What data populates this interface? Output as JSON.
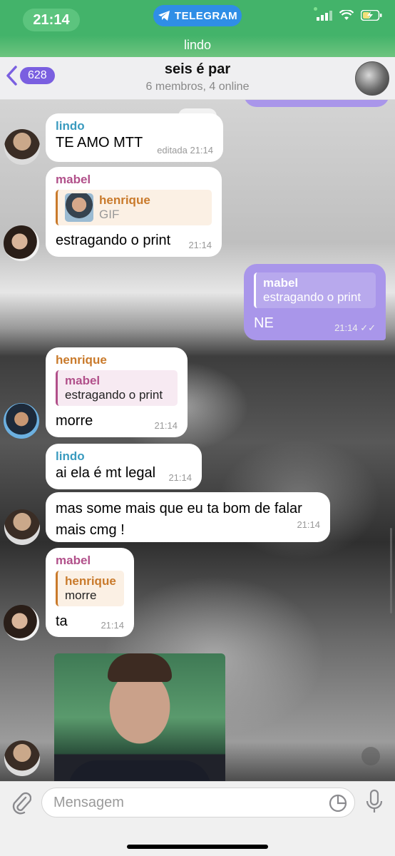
{
  "status": {
    "time": "21:14",
    "app_pill": "TELEGRAM"
  },
  "chat_name_bar": "lindo",
  "header": {
    "back_count": "628",
    "title": "seis é par",
    "subtitle": "6 membros, 4 online"
  },
  "messages": {
    "m1": {
      "sender": "lindo",
      "text": "TE AMO MTT",
      "time": "editada 21:14"
    },
    "m2": {
      "sender": "mabel",
      "reply_name": "henrique",
      "reply_text": "GIF",
      "text": "estragando o print",
      "time": "21:14"
    },
    "m3": {
      "reply_name": "mabel",
      "reply_text": "estragando o print",
      "text": "NE",
      "time": "21:14 ✓✓"
    },
    "m4": {
      "sender": "henrique",
      "reply_name": "mabel",
      "reply_text": "estragando o print",
      "text": "morre",
      "time": "21:14"
    },
    "m5": {
      "sender": "lindo",
      "text": "ai ela é mt legal",
      "time": "21:14"
    },
    "m6": {
      "text_line1": "mas some mais que eu ta bom de falar",
      "text_line2": "mais cmg !",
      "time": "21:14"
    },
    "m7": {
      "sender": "mabel",
      "reply_name": "henrique",
      "reply_text": "morre",
      "text": "ta",
      "time": "21:14"
    }
  },
  "input": {
    "placeholder": "Mensagem"
  },
  "colors": {
    "status_green": "#43b36a",
    "accent_purple": "#7a5fe0",
    "outgoing_bubble": "#a996ea"
  }
}
